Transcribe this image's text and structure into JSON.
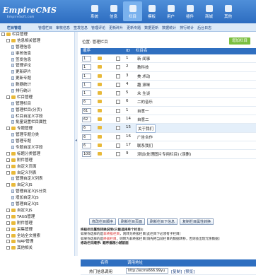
{
  "header": {
    "logo": "EmpireCMS",
    "logo_sub": "EmpireSoft.com",
    "nav": [
      "系统",
      "信息",
      "栏目",
      "模板",
      "用户",
      "插件",
      "商城",
      "其他"
    ],
    "active_nav": 2
  },
  "subnav": {
    "label": "栏目管理",
    "items": [
      "管理栏目",
      "审核信息",
      "签发信息",
      "管理评论",
      "更新碎片",
      "更新专题",
      "数据更新",
      "数据统计",
      "排行统计",
      "后台日志"
    ]
  },
  "sidebar": {
    "items": [
      {
        "label": "栏目管理",
        "level": 0,
        "kind": "root"
      },
      {
        "label": "信息相关管理",
        "level": 1,
        "kind": "folder"
      },
      {
        "label": "管理信息",
        "level": 2,
        "kind": "page"
      },
      {
        "label": "审核信息",
        "level": 2,
        "kind": "page"
      },
      {
        "label": "签发信息",
        "level": 2,
        "kind": "page"
      },
      {
        "label": "管理评论",
        "level": 2,
        "kind": "page"
      },
      {
        "label": "更新碎片",
        "level": 2,
        "kind": "page"
      },
      {
        "label": "更新专题",
        "level": 2,
        "kind": "page"
      },
      {
        "label": "数据统计",
        "level": 2,
        "kind": "page"
      },
      {
        "label": "排行统计",
        "level": 2,
        "kind": "page"
      },
      {
        "label": "栏目管理",
        "level": 1,
        "kind": "folder"
      },
      {
        "label": "管理栏目",
        "level": 2,
        "kind": "page"
      },
      {
        "label": "管理栏目(分页)",
        "level": 2,
        "kind": "page"
      },
      {
        "label": "栏目自定义字段",
        "level": 2,
        "kind": "page"
      },
      {
        "label": "批量设置栏目属性",
        "level": 2,
        "kind": "page"
      },
      {
        "label": "专题管理",
        "level": 1,
        "kind": "folder"
      },
      {
        "label": "管理专题分类",
        "level": 2,
        "kind": "page"
      },
      {
        "label": "管理专题",
        "level": 2,
        "kind": "page"
      },
      {
        "label": "专题自定义字段",
        "level": 2,
        "kind": "page"
      },
      {
        "label": "标题分类管理",
        "level": 1,
        "kind": "folder"
      },
      {
        "label": "附件管理",
        "level": 1,
        "kind": "folder"
      },
      {
        "label": "自定义页面",
        "level": 1,
        "kind": "folder"
      },
      {
        "label": "自定义列表",
        "level": 1,
        "kind": "folder"
      },
      {
        "label": "管理自定义列表",
        "level": 2,
        "kind": "page"
      },
      {
        "label": "自定义JS",
        "level": 1,
        "kind": "folder"
      },
      {
        "label": "管理自定义JS分类",
        "level": 2,
        "kind": "page"
      },
      {
        "label": "增加自定义JS",
        "level": 2,
        "kind": "page"
      },
      {
        "label": "管理自定义JS",
        "level": 2,
        "kind": "page"
      },
      {
        "label": "自定义JS",
        "level": 1,
        "kind": "folder"
      },
      {
        "label": "TAGS管理",
        "level": 1,
        "kind": "folder"
      },
      {
        "label": "附件管理",
        "level": 1,
        "kind": "folder"
      },
      {
        "label": "采集管理",
        "level": 1,
        "kind": "folder"
      },
      {
        "label": "全站全文搜索",
        "level": 1,
        "kind": "folder"
      },
      {
        "label": "WAP管理",
        "level": 1,
        "kind": "folder"
      },
      {
        "label": "其他相关",
        "level": 1,
        "kind": "folder"
      }
    ]
  },
  "main": {
    "location": "位置: 管理栏目",
    "add_button": "增加栏目",
    "columns": [
      "顺序",
      "",
      "",
      "ID",
      "栏目名"
    ],
    "rows": [
      {
        "order": "1",
        "id": "1",
        "name": "新 闻事"
      },
      {
        "order": "1",
        "id": "2",
        "name": "教科技"
      },
      {
        "order": "1",
        "id": "3",
        "name": "美 术动"
      },
      {
        "order": "1",
        "id": "4",
        "name": "趣 滚咪"
      },
      {
        "order": "1",
        "id": "5",
        "name": "众 生谈"
      },
      {
        "order": "6",
        "id": "6",
        "name": "二的音乐"
      },
      {
        "order": "61",
        "id": "1",
        "name": "自意一"
      },
      {
        "order": "62",
        "id": "14",
        "name": "自意二"
      },
      {
        "order": "6",
        "id": "15",
        "name": "关于我们",
        "highlight": true
      },
      {
        "order": "6",
        "id": "16",
        "name": "广告合作"
      },
      {
        "order": "6",
        "id": "17",
        "name": "联系我们"
      },
      {
        "order": "100",
        "id": "9",
        "name": "添加(处理图片专用栏目) (误删)"
      }
    ],
    "buttons": [
      "修改栏目顺序",
      "刷新栏目页面",
      "刷新栏目下信息",
      "复制栏目属性转换"
    ],
    "notes": {
      "title": "终极栏目属性转换说明(只能选择单个栏目):",
      "line1": "如果你选择的是非终极栏目，则转为终极栏目[此栏目下必须有子栏目]",
      "line2": "如果你选择的是终极栏目，则转为非终极栏目[请先把当前栏目的数据转移，否则会出现冗余数据]",
      "line3": "修改栏目顺序: 顺序值越小越前面"
    },
    "legend": {
      "head_name": "名称",
      "head_addr": "调用地址",
      "row_name": "热门信息调用",
      "row_url": "http://ecms666.99yu",
      "row_copy": "[复制]",
      "row_preview": "[预览]"
    }
  }
}
